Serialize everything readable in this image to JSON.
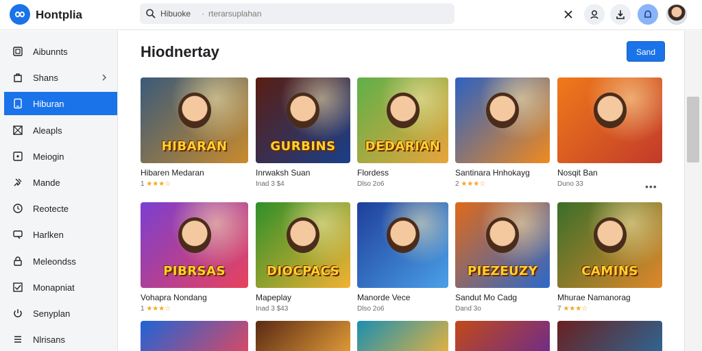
{
  "app": {
    "title": "Hontplia"
  },
  "search": {
    "value": "Hibuoke",
    "placeholder": "rterarsuplahan",
    "separator": "·"
  },
  "toolbar": {
    "icons": [
      "close-icon",
      "person-search-icon",
      "download-icon",
      "account-icon",
      "avatar"
    ]
  },
  "sidebar": {
    "items": [
      {
        "label": "Aibunnts",
        "icon": "album-icon",
        "active": false
      },
      {
        "label": "Shans",
        "icon": "bag-icon",
        "active": false,
        "has_chevron": true
      },
      {
        "label": "Hiburan",
        "icon": "phone-icon",
        "active": true
      },
      {
        "label": "Aleapls",
        "icon": "grid-icon",
        "active": false
      },
      {
        "label": "Meiogin",
        "icon": "tablet-icon",
        "active": false
      },
      {
        "label": "Mande",
        "icon": "pin-icon",
        "active": false
      },
      {
        "label": "Reotecte",
        "icon": "clock-icon",
        "active": false
      },
      {
        "label": "Harlken",
        "icon": "chat-icon",
        "active": false
      },
      {
        "label": "Meleondss",
        "icon": "lock-icon",
        "active": false
      },
      {
        "label": "Monapniat",
        "icon": "checklist-icon",
        "active": false
      },
      {
        "label": "Senyplan",
        "icon": "power-icon",
        "active": false
      },
      {
        "label": "Nlrisans",
        "icon": "list-icon",
        "active": false
      }
    ]
  },
  "main": {
    "heading": "Hiodnertay",
    "send_button": "Sand",
    "more_label": "•••",
    "cards": [
      {
        "name": "Hibaren Medaran",
        "meta": "1 ★★★☆",
        "thumb_text": "HIBARAN",
        "c1": "#3a5a7a",
        "c2": "#c98b2d"
      },
      {
        "name": "Inrwaksh Suan",
        "meta": "Inad 3 $4",
        "thumb_text": "GURBINS",
        "c1": "#5a1e12",
        "c2": "#1a3f8a"
      },
      {
        "name": "Flordess",
        "meta": "Dlso 2o6",
        "thumb_text": "DEDARIAN",
        "c1": "#5fb04a",
        "c2": "#e9a43b"
      },
      {
        "name": "Santinara Hnhokayg",
        "meta": "2 ★★★☆",
        "thumb_text": "",
        "c1": "#2d62c2",
        "c2": "#f08a1e"
      },
      {
        "name": "Nosqit Ban",
        "meta": "Duno 33",
        "thumb_text": "",
        "c1": "#f07a1a",
        "c2": "#c23a2a"
      },
      {
        "name": "Vohapra Nondang",
        "meta": "1 ★★★☆",
        "thumb_text": "PIBRSAS",
        "c1": "#7b3fd0",
        "c2": "#e8425c"
      },
      {
        "name": "Mapeplay",
        "meta": "Inad 3 $43",
        "thumb_text": "DIOCPACS",
        "c1": "#2f8f2a",
        "c2": "#f2b233"
      },
      {
        "name": "Manorde Vece",
        "meta": "Dlso 2o6",
        "thumb_text": "",
        "c1": "#1f3f9a",
        "c2": "#4aa0e8"
      },
      {
        "name": "Sandut Mo Cadg",
        "meta": "Dand 3o",
        "thumb_text": "PIEZEUZY",
        "c1": "#e06a1a",
        "c2": "#2c68c9"
      },
      {
        "name": "Mhurae Namanorag",
        "meta": "7 ★★★☆",
        "thumb_text": "CAMINS",
        "c1": "#3a6e2a",
        "c2": "#e0882a"
      }
    ],
    "row3": [
      {
        "c1": "#1f64d6",
        "c2": "#e4485e"
      },
      {
        "c1": "#5a2a14",
        "c2": "#e8a23a"
      },
      {
        "c1": "#1b8fb0",
        "c2": "#f0b43a"
      },
      {
        "c1": "#c24a1a",
        "c2": "#6a2a90"
      },
      {
        "c1": "#6a2020",
        "c2": "#2a6a9a"
      }
    ]
  },
  "colors": {
    "accent": "#1a73e8",
    "sidebar_bg": "#f4f5f7",
    "star": "#f5a623"
  }
}
